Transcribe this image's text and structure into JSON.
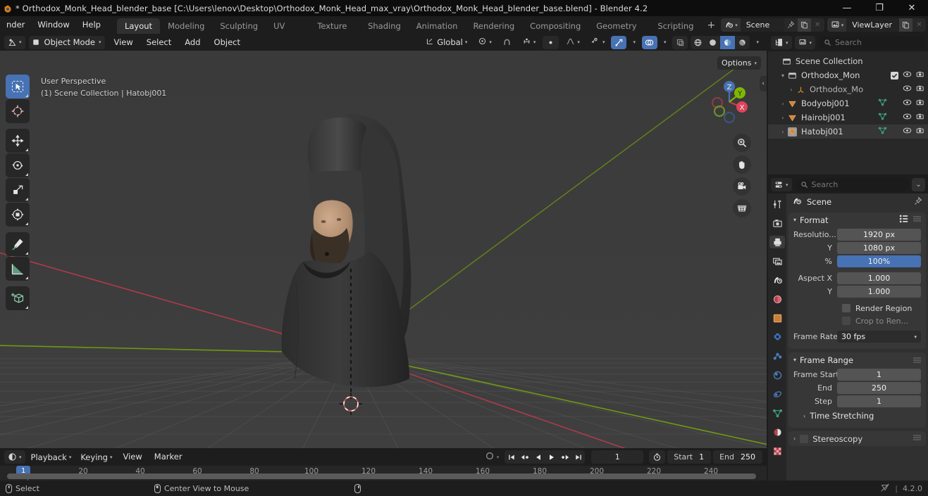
{
  "titlebar": {
    "title": "* Orthodox_Monk_Head_blender_base [C:\\Users\\lenov\\Desktop\\Orthodox_Monk_Head_max_vray\\Orthodox_Monk_Head_blender_base.blend] - Blender 4.2",
    "minimize": "—",
    "maximize": "❐",
    "close": "✕"
  },
  "menus": [
    {
      "label": "nder"
    },
    {
      "label": "Window"
    },
    {
      "label": "Help"
    }
  ],
  "workspace_tabs": [
    {
      "label": "Layout",
      "active": true
    },
    {
      "label": "Modeling",
      "active": false
    },
    {
      "label": "Sculpting",
      "active": false
    },
    {
      "label": "UV Editing",
      "active": false
    },
    {
      "label": "Texture Paint",
      "active": false
    },
    {
      "label": "Shading",
      "active": false
    },
    {
      "label": "Animation",
      "active": false
    },
    {
      "label": "Rendering",
      "active": false
    },
    {
      "label": "Compositing",
      "active": false
    },
    {
      "label": "Geometry Nodes",
      "active": false
    },
    {
      "label": "Scripting",
      "active": false
    }
  ],
  "workspace_add": "+",
  "scene_selector": {
    "name": "Scene",
    "icon": "scene-icon",
    "pin": "pin-icon",
    "copy": "new-scene-icon",
    "remove": "✕"
  },
  "viewlayer_selector": {
    "name": "ViewLayer",
    "icon": "viewlayer-icon",
    "copy": "new-viewlayer-icon",
    "remove": "✕"
  },
  "viewport_header": {
    "editor_type": "editor-type-icon",
    "mode": "Object Mode",
    "menus": [
      "View",
      "Select",
      "Add",
      "Object"
    ],
    "transform_orientation": "Global",
    "pivot": "pivot-icon",
    "snap": "snap-magnet-icon",
    "snap_to": "snap-increment-icon",
    "proportional": "proportional-edit-icon",
    "falloff": "falloff-curve-icon",
    "visibility": "object-visibility-icon",
    "gizmo": "gizmo-icon",
    "overlays": "overlays-icon",
    "xray": "xray-icon",
    "shading_modes": [
      "wireframe",
      "solid",
      "material-preview",
      "rendered"
    ],
    "shading_active_index": 2,
    "options": "Options"
  },
  "viewport": {
    "perspective": "User Perspective",
    "breadcrumb": "(1) Scene Collection | Hatobj001",
    "gizmo_axes": [
      {
        "label": "Z",
        "color": "#4772b3"
      },
      {
        "label": "Y",
        "color": "#7fb800"
      },
      {
        "label": "X",
        "color": "#e04050"
      }
    ],
    "nav_buttons": [
      "zoom-icon",
      "pan-hand-icon",
      "camera-view-icon",
      "toggle-ortho-grid-icon"
    ],
    "collapse": "‹"
  },
  "toolbar": [
    {
      "name": "tweak-select-box-tool",
      "active": true
    },
    {
      "name": "cursor-tool",
      "active": false
    },
    {
      "name": "move-tool",
      "active": false
    },
    {
      "name": "rotate-tool",
      "active": false
    },
    {
      "name": "scale-tool",
      "active": false
    },
    {
      "name": "transform-tool",
      "active": false
    },
    {
      "name": "annotate-tool",
      "active": false
    },
    {
      "name": "measure-tool",
      "active": false
    },
    {
      "name": "add-cube-tool",
      "active": false
    }
  ],
  "timeline": {
    "editor_icon": "timeline-editor-icon",
    "menus": [
      "Playback",
      "Keying",
      "View",
      "Marker"
    ],
    "auto_keying": "record-icon",
    "playback_buttons": [
      "jump-to-start",
      "jump-prev-keyframe",
      "play-reverse",
      "play",
      "jump-next-keyframe",
      "jump-to-end"
    ],
    "current_frame": "1",
    "use_preview_icon": "stopwatch-icon",
    "start_label": "Start",
    "start_value": "1",
    "end_label": "End",
    "end_value": "250",
    "ticks": [
      "20",
      "40",
      "60",
      "80",
      "100",
      "120",
      "140",
      "160",
      "180",
      "200",
      "220",
      "240"
    ],
    "playhead_label": "1"
  },
  "outliner": {
    "display_mode_icon": "outliner-display-mode-icon",
    "filter_icon": "outliner-filter-icon",
    "search_placeholder": "Search",
    "rows": [
      {
        "label": "Scene Collection",
        "depth": 0,
        "icon": "collection-icon",
        "arrow": "",
        "selected": false,
        "checkbox": false,
        "mesh": false,
        "eye": false,
        "camera": false
      },
      {
        "label": "Orthodox_Monk_H",
        "depth": 1,
        "icon": "collection-icon",
        "arrow": "▾",
        "selected": false,
        "checkbox": true,
        "mesh": false,
        "eye": true,
        "camera": true
      },
      {
        "label": "Orthodox_Mon",
        "depth": 2,
        "icon": "empty-axes-icon",
        "arrow": "›",
        "selected": false,
        "checkbox": false,
        "mesh": false,
        "eye": true,
        "camera": true
      },
      {
        "label": "Bodyobj001",
        "depth": 1,
        "icon": "mesh-object-icon",
        "arrow": "›",
        "selected": false,
        "checkbox": false,
        "mesh": true,
        "eye": true,
        "camera": true
      },
      {
        "label": "Hairobj001",
        "depth": 1,
        "icon": "mesh-object-icon",
        "arrow": "›",
        "selected": false,
        "checkbox": false,
        "mesh": true,
        "eye": true,
        "camera": true
      },
      {
        "label": "Hatobj001",
        "depth": 1,
        "icon": "mesh-object-icon",
        "arrow": "›",
        "selected": true,
        "checkbox": false,
        "mesh": true,
        "eye": true,
        "camera": true
      }
    ]
  },
  "properties": {
    "editor_icon": "properties-editor-icon",
    "search_placeholder": "Search",
    "options_chevron": "⌄",
    "breadcrumb": "Scene",
    "breadcrumb_icon": "scene-icon",
    "pin_icon": "pin-icon",
    "tabs": [
      {
        "name": "tool-tab",
        "active": false
      },
      {
        "name": "render-tab",
        "active": false
      },
      {
        "name": "output-tab",
        "active": true
      },
      {
        "name": "view-layer-tab",
        "active": false
      },
      {
        "name": "scene-tab",
        "active": false
      },
      {
        "name": "world-tab",
        "active": false
      },
      {
        "name": "object-tab",
        "active": false
      },
      {
        "name": "modifier-tab",
        "active": false
      },
      {
        "name": "particles-tab",
        "active": false
      },
      {
        "name": "physics-tab",
        "active": false
      },
      {
        "name": "constraints-tab",
        "active": false
      },
      {
        "name": "object-data-tab",
        "active": false
      },
      {
        "name": "material-tab",
        "active": false
      },
      {
        "name": "texture-tab",
        "active": false
      }
    ],
    "format_panel": {
      "title": "Format",
      "fields": [
        {
          "label": "Resolutio...",
          "value": "1920 px",
          "accent": false
        },
        {
          "label": "Y",
          "value": "1080 px",
          "accent": false
        },
        {
          "label": "%",
          "value": "100%",
          "accent": true
        },
        {
          "label": "Aspect X",
          "value": "1.000",
          "accent": false
        },
        {
          "label": "Y",
          "value": "1.000",
          "accent": false
        }
      ],
      "checkboxes": [
        {
          "label": "Render Region",
          "dim": false
        },
        {
          "label": "Crop to Ren...",
          "dim": true
        }
      ],
      "frame_rate_label": "Frame Rate",
      "frame_rate_value": "30 fps"
    },
    "frame_range_panel": {
      "title": "Frame Range",
      "fields": [
        {
          "label": "Frame Start",
          "value": "1"
        },
        {
          "label": "End",
          "value": "250"
        },
        {
          "label": "Step",
          "value": "1"
        }
      ],
      "subpanel": "Time Stretching"
    },
    "stereoscopy_panel": {
      "title": "Stereoscopy"
    }
  },
  "statusbar": {
    "items": [
      {
        "mouse": "left",
        "label": "Select"
      },
      {
        "mouse": "middle",
        "label": "Center View to Mouse"
      },
      {
        "mouse": "right",
        "label": ""
      }
    ],
    "scene_stats_icon": "scene-stats-icon",
    "version": "4.2.0"
  },
  "colors": {
    "accent": "#4772b3",
    "axis_x": "#e04050",
    "axis_y": "#7fb800",
    "axis_z": "#4772b3",
    "viewport_bg": "#3d3d3d",
    "panel_bg": "#303030",
    "header_bg": "#1d1d1d"
  }
}
